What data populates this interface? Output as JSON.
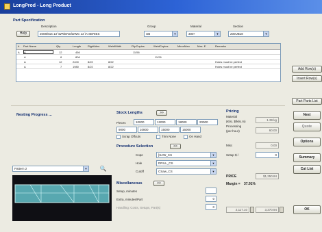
{
  "window": {
    "title": "LongProd - Long Product"
  },
  "part_spec": {
    "title": "Part Specification",
    "help_label": "Help",
    "description_label": "Description",
    "description_value": "2008/816 13 \\WR\\ENG\\DWG 13 \\A SERIES",
    "group_label": "Group",
    "group_value": "UB",
    "material_label": "Material",
    "material_value": "300+",
    "section_label": "Section",
    "section_value": "200UB18"
  },
  "grid": {
    "headers": [
      "#",
      "Part Name",
      "Qty",
      "Length",
      "RightAlen",
      "WeldWidth",
      "FlipCopies",
      "WeldCopies",
      "MinorMan",
      "Max. E",
      "Remarks"
    ],
    "rows": [
      {
        "num": "A",
        "part": "A",
        "qty": "12",
        "length": "456",
        "right": "",
        "weld": "",
        "flip": "11/56",
        "weldc": "",
        "minor": "",
        "max": "",
        "remarks": ""
      },
      {
        "num": "",
        "part": "A",
        "qty": "8",
        "length": "806",
        "right": "",
        "weld": "",
        "flip": "",
        "weldc": "11/26",
        "minor": "",
        "max": "",
        "remarks": ""
      },
      {
        "num": "",
        "part": "A",
        "qty": "12",
        "length": "2400",
        "right": "8/22",
        "weld": "8/22",
        "flip": "",
        "weldc": "",
        "minor": "",
        "max": "",
        "remarks": "Holes must be perfect"
      },
      {
        "num": "",
        "part": "A",
        "qty": "7",
        "length": "1980",
        "right": "8/22",
        "weld": "8/22",
        "flip": "",
        "weldc": "",
        "minor": "",
        "max": "",
        "remarks": "Holes must be perfect"
      }
    ]
  },
  "side_buttons": {
    "add_row": "Add Row(s)",
    "insert_row": "Insert Row(s)",
    "part_list": "Part Parts List"
  },
  "nesting": {
    "title": "Nesting Progress ...",
    "pattern_value": "Pattern 2"
  },
  "stock": {
    "title": "Stock Lengths",
    "btn": ">>",
    "pieces_label": "Pieces",
    "row1": [
      "10000",
      "12000",
      "18000",
      "20000"
    ],
    "row2": [
      "9000",
      "10800",
      "15000",
      "16000"
    ],
    "opt1": "Scrap Offcuts",
    "opt2": "Trim None",
    "opt3": "On Hand"
  },
  "procedure": {
    "title": "Procedure Selection",
    "btn": ">>",
    "cope_label": "Cope",
    "cope_value": "[SAW_CS",
    "hole_label": "Hole",
    "hole_value": "DRILL_CS",
    "cutoff_label": "Cutoff",
    "cutoff_value": "CSaw_CS"
  },
  "misc": {
    "title": "Miscellaneous",
    "btn": ">>",
    "setup_label": "Setup, minutes",
    "setup_value": "",
    "extra_label": "Extra, minutes/Part",
    "extra_value": "0",
    "handling_label": "Handling: Costs, Setups, Part(s)",
    "handling_value": "0"
  },
  "pricing": {
    "title": "Pricing",
    "material_label": "Material",
    "material_sub": "(Kilo. $/kilo.m)",
    "material_value": "1.39 kg",
    "processing_label": "Processing",
    "processing_sub": "(per hour)",
    "processing_value": "60.00",
    "misc_label": "Misc",
    "misc_value": "0.00",
    "setup_label": "Setup $ /",
    "setup_value": "0",
    "price_label": "PRICE",
    "price_value": "$1,250.84",
    "margin_label": "Margin =",
    "margin_value": "37.91%",
    "total_left": "2,117.10",
    "total_right": "3,370.94"
  },
  "right_buttons": {
    "nest": "Nest",
    "quote": "Quote",
    "options": "Options",
    "summary": "Summary",
    "cut_list": "Cut List",
    "ok": "OK"
  }
}
